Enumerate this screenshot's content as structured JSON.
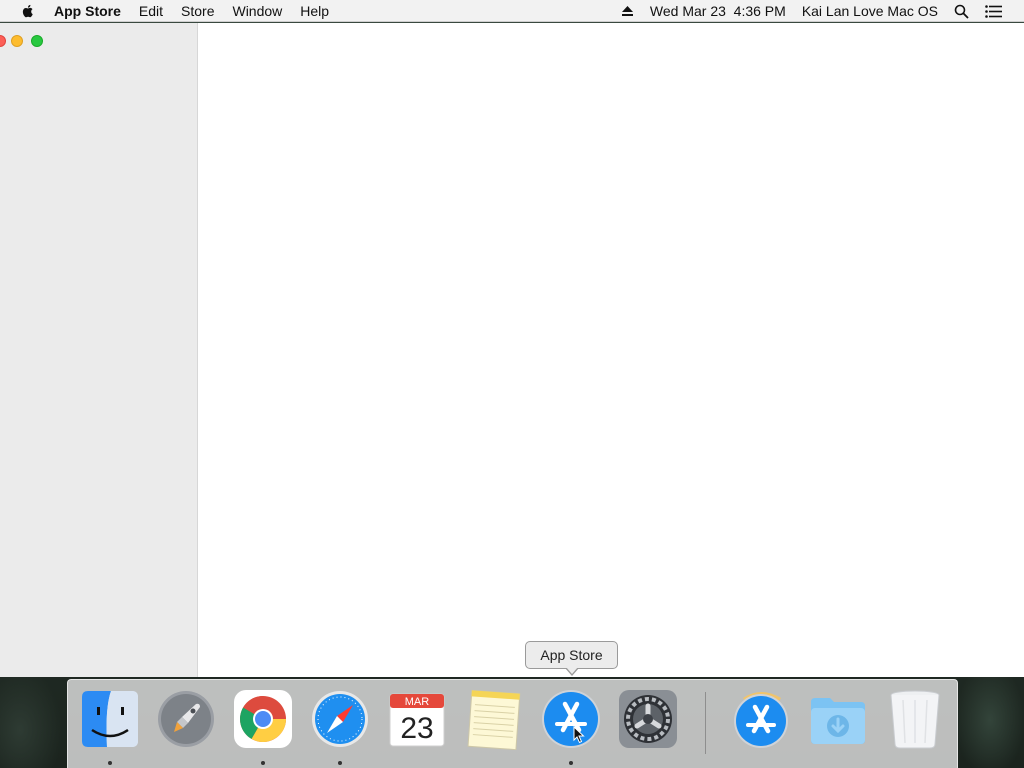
{
  "menubar": {
    "app_name": "App Store",
    "menus": [
      "Edit",
      "Store",
      "Window",
      "Help"
    ],
    "date": "Wed Mar 23",
    "time": "4:36 PM",
    "user": "Kai Lan Love Mac OS",
    "icons": [
      "apple-icon",
      "eject-icon",
      "spotlight-search-icon",
      "notification-center-icon"
    ]
  },
  "window": {
    "traffic_lights": [
      "close",
      "minimize",
      "zoom"
    ],
    "colors": {
      "close": "#fc5f57",
      "minimize": "#fdbc2e",
      "zoom": "#28c840"
    }
  },
  "dock": {
    "tooltip": "App Store",
    "calendar_month": "MAR",
    "calendar_day": "23",
    "apps": [
      {
        "name": "finder-icon",
        "running": true
      },
      {
        "name": "launchpad-icon",
        "running": false
      },
      {
        "name": "chrome-icon",
        "running": true
      },
      {
        "name": "safari-icon",
        "running": true
      },
      {
        "name": "calendar-icon",
        "running": false
      },
      {
        "name": "notes-icon",
        "running": false
      },
      {
        "name": "app-store-icon",
        "running": true
      },
      {
        "name": "system-preferences-icon",
        "running": false
      },
      {
        "name": "app-store-installer-icon",
        "running": false
      },
      {
        "name": "downloads-folder-icon",
        "running": false
      },
      {
        "name": "trash-icon",
        "running": false
      }
    ]
  }
}
